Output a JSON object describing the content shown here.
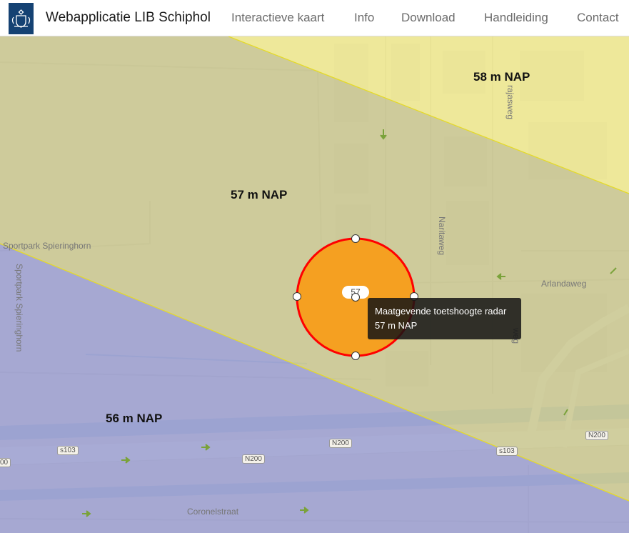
{
  "header": {
    "brand": "Webapplicatie LIB Schiphol",
    "nav": [
      "Interactieve kaart",
      "Info",
      "Download",
      "Handleiding",
      "Contact"
    ]
  },
  "map": {
    "zones": [
      {
        "label": "58 m NAP",
        "color": "#f1ea87"
      },
      {
        "label": "57 m NAP",
        "color": "#c9c78f"
      },
      {
        "label": "56 m NAP",
        "color": "#9a9dd0"
      }
    ],
    "circle": {
      "label": "57",
      "fill": "#f5a021",
      "stroke": "#ff0000"
    },
    "tooltip": {
      "title": "Maatgevende toetshoogte radar",
      "value": "57 m NAP"
    },
    "streets": [
      "Sportpark Spieringhorn",
      "Sportpark Spieringhorn",
      "Naritaweg",
      "Arlandaweg",
      "Coronelstraat",
      "rajasweg",
      "weg"
    ],
    "road_shields": [
      "s103",
      "N200",
      "N200",
      "s103",
      "N200",
      "00"
    ]
  }
}
